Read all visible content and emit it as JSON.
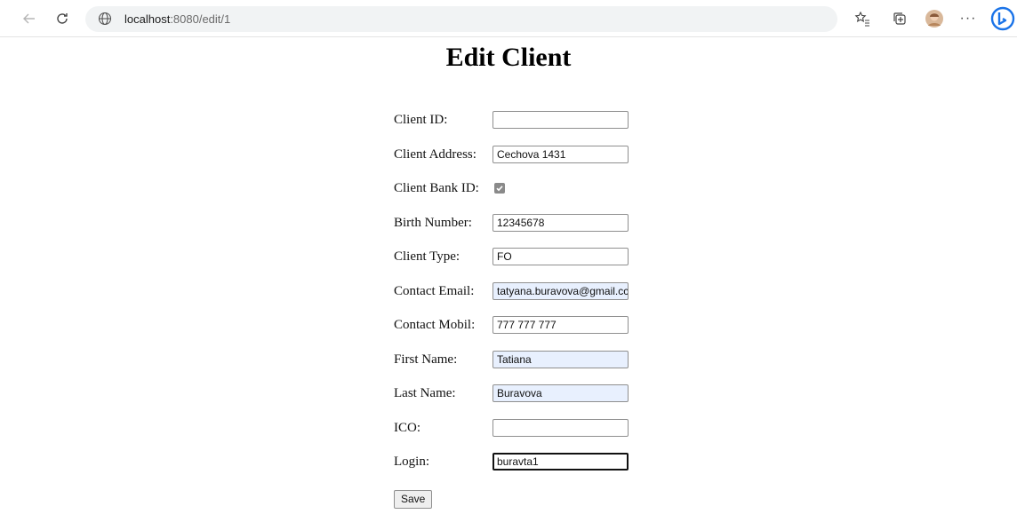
{
  "browser": {
    "url_host": "localhost",
    "url_rest": ":8080/edit/1",
    "icons": [
      "back-arrow-icon",
      "refresh-icon",
      "globe-icon",
      "favorites-star-icon",
      "collections-icon",
      "profile-avatar-icon",
      "more-menu-icon",
      "bing-icon"
    ]
  },
  "page": {
    "title": "Edit Client"
  },
  "form": {
    "fields": [
      {
        "label": "Client ID:",
        "value": ""
      },
      {
        "label": "Client Address:",
        "value": "Cechova 1431"
      },
      {
        "label": "Client Bank ID:",
        "checked": true
      },
      {
        "label": "Birth Number:",
        "value": "12345678"
      },
      {
        "label": "Client Type:",
        "value": "FO"
      },
      {
        "label": "Contact Email:",
        "value": "tatyana.buravova@gmail.cc"
      },
      {
        "label": "Contact Mobil:",
        "value": "777 777 777"
      },
      {
        "label": "First Name:",
        "value": "Tatiana"
      },
      {
        "label": "Last Name:",
        "value": "Buravova"
      },
      {
        "label": "ICO:",
        "value": ""
      },
      {
        "label": "Login:",
        "value": "buravta1"
      }
    ],
    "save_label": "Save"
  },
  "colors": {
    "autofill": "#e8f0fe",
    "bing_blue": "#1a73e8"
  }
}
